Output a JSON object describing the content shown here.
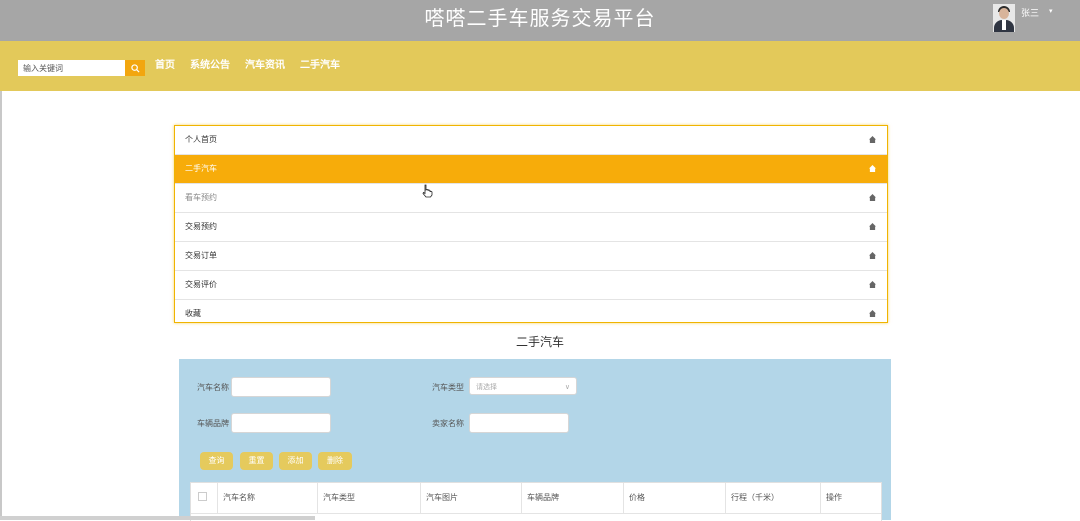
{
  "header": {
    "site_title": "嗒嗒二手车服务交易平台",
    "user_name": "张三",
    "user_caret": "▾"
  },
  "navbar": {
    "search_placeholder": "输入关键词",
    "links": [
      "首页",
      "系统公告",
      "汽车资讯",
      "二手汽车"
    ]
  },
  "menu": {
    "items": [
      {
        "label": "个人首页",
        "state": "normal"
      },
      {
        "label": "二手汽车",
        "state": "active"
      },
      {
        "label": "看车预约",
        "state": "dim"
      },
      {
        "label": "交易预约",
        "state": "normal"
      },
      {
        "label": "交易订单",
        "state": "normal"
      },
      {
        "label": "交易评价",
        "state": "normal"
      },
      {
        "label": "收藏",
        "state": "normal"
      }
    ],
    "item_icon": "home-icon"
  },
  "section": {
    "title": "二手汽车"
  },
  "filters": {
    "car_name_label": "汽车名称",
    "car_type_label": "汽车类型",
    "car_type_placeholder": "请选择",
    "plate_label": "车辆品牌",
    "seller_label": "卖家名称"
  },
  "buttons": {
    "search": "查询",
    "reset": "重置",
    "add": "添加",
    "delete": "删除"
  },
  "table": {
    "columns": [
      "汽车名称",
      "汽车类型",
      "汽车图片",
      "车辆品牌",
      "价格",
      "行程（千米）",
      "操作"
    ]
  },
  "colors": {
    "topbar": "#a6a6a6",
    "navbar": "#e3c95a",
    "accent": "#f7ac0a",
    "panel": "#b3d6e8",
    "button": "#e5ca5d"
  }
}
